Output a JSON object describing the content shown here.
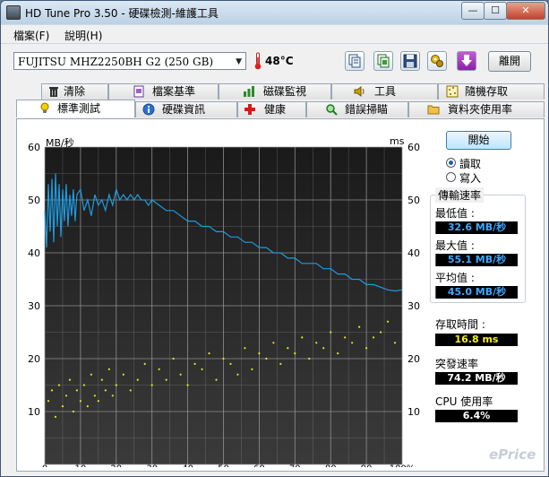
{
  "window": {
    "title": "HD Tune Pro 3.50 - 硬碟檢測-維護工具"
  },
  "title_buttons": {
    "minimize": "—",
    "maximize": "☐",
    "close": "✕"
  },
  "menu": {
    "items": [
      "檔案(F)",
      "說明(H)"
    ]
  },
  "toolbar": {
    "drive": "FUJITSU MHZ2250BH G2 (250 GB)",
    "temperature": "48°C",
    "icons": [
      "copy-text-icon",
      "copy-screenshot-icon",
      "save-icon",
      "options-icon",
      "download-icon"
    ],
    "exit_label": "離開"
  },
  "tabs": {
    "top_row": [
      {
        "label": "清除",
        "icon": "trash-icon"
      },
      {
        "label": "檔案基準",
        "icon": "file-benchmark-icon"
      },
      {
        "label": "磁碟監視",
        "icon": "disk-monitor-icon"
      },
      {
        "label": "工具",
        "icon": "speaker-icon"
      },
      {
        "label": "隨機存取",
        "icon": "random-access-icon"
      }
    ],
    "bottom_row": [
      {
        "label": "標準測試",
        "icon": "lightbulb-icon",
        "active": true
      },
      {
        "label": "硬碟資訊",
        "icon": "info-icon"
      },
      {
        "label": "健康",
        "icon": "health-cross-icon"
      },
      {
        "label": "錯誤掃瞄",
        "icon": "magnifier-icon"
      },
      {
        "label": "資料夾使用率",
        "icon": "folder-icon"
      }
    ]
  },
  "controls": {
    "start_label": "開始",
    "read_label": "讀取",
    "write_label": "寫入",
    "selected_mode": "讀取"
  },
  "stats": {
    "transfer_rate_title": "傳輸速率",
    "min_label": "最低值 :",
    "min_value": "32.6 MB/秒",
    "max_label": "最大值 :",
    "max_value": "55.1 MB/秒",
    "avg_label": "平均值 :",
    "avg_value": "45.0 MB/秒",
    "access_time_label": "存取時間 :",
    "access_time_value": "16.8 ms",
    "burst_label": "突發速率",
    "burst_value": "74.2 MB/秒",
    "cpu_label": "CPU 使用率",
    "cpu_value": "6.4%"
  },
  "watermark": "ePrice",
  "colors": {
    "transfer_line": "#1e9be0",
    "access_dots": "#e6e62a",
    "plot_bg": "#242424",
    "grid": "#9a9a9a"
  },
  "chart_data": {
    "type": "line",
    "left_axis_label": "MB/秒",
    "right_axis_label": "ms",
    "ylim": [
      0,
      60
    ],
    "yticks": [
      10,
      20,
      30,
      40,
      50,
      60
    ],
    "xlim": [
      0,
      100
    ],
    "xticks": [
      "0",
      "10",
      "20",
      "30",
      "40",
      "50",
      "60",
      "70",
      "80",
      "90",
      "100%"
    ],
    "grid": true,
    "series": [
      {
        "style": "line",
        "x": [
          0,
          0.5,
          1,
          1.5,
          2,
          2.5,
          3,
          3.5,
          4,
          4.5,
          5,
          5.5,
          6,
          6.5,
          7,
          7.5,
          8,
          8.5,
          9,
          10,
          11,
          12,
          13,
          14,
          15,
          16,
          17,
          18,
          19,
          20,
          21,
          22,
          23,
          24,
          25,
          26,
          27,
          28,
          29,
          30,
          32,
          34,
          36,
          38,
          40,
          42,
          44,
          46,
          48,
          50,
          52,
          54,
          56,
          58,
          60,
          62,
          64,
          66,
          68,
          70,
          72,
          74,
          76,
          78,
          80,
          82,
          84,
          86,
          88,
          90,
          92,
          94,
          96,
          98,
          100
        ],
        "y": [
          48,
          41,
          53,
          44,
          54,
          42,
          55,
          45,
          53,
          43,
          52,
          46,
          53,
          45,
          51,
          47,
          52,
          46,
          51,
          52,
          48,
          50,
          47,
          51,
          49,
          50,
          48,
          51,
          49,
          52,
          50,
          51,
          50,
          51,
          50,
          51,
          50,
          50,
          49,
          50,
          49,
          48,
          48,
          47,
          46,
          46,
          45,
          45,
          44,
          44,
          43,
          43,
          42,
          42,
          41,
          41,
          40,
          40,
          39,
          39,
          38,
          38,
          38,
          37,
          37,
          36,
          36,
          35,
          35,
          34,
          34,
          33.5,
          33,
          32.8,
          33
        ]
      },
      {
        "style": "scatter",
        "x": [
          1,
          2,
          3,
          4,
          5,
          6,
          7,
          8,
          9,
          10,
          11,
          12,
          13,
          14,
          15,
          16,
          17,
          18,
          19,
          20,
          22,
          24,
          26,
          28,
          30,
          32,
          34,
          36,
          38,
          40,
          42,
          44,
          46,
          48,
          50,
          52,
          54,
          56,
          58,
          60,
          62,
          64,
          66,
          68,
          70,
          72,
          74,
          76,
          78,
          80,
          82,
          84,
          86,
          88,
          90,
          92,
          94,
          96,
          98
        ],
        "y": [
          12,
          14,
          9,
          15,
          11,
          13,
          16,
          10,
          14,
          12,
          15,
          11,
          17,
          13,
          12,
          16,
          14,
          18,
          13,
          15,
          17,
          14,
          16,
          19,
          15,
          18,
          16,
          20,
          17,
          15,
          19,
          18,
          21,
          16,
          20,
          19,
          17,
          22,
          18,
          21,
          20,
          23,
          19,
          22,
          21,
          24,
          20,
          23,
          22,
          25,
          21,
          24,
          23,
          26,
          22,
          24,
          25,
          27,
          23
        ]
      }
    ]
  }
}
